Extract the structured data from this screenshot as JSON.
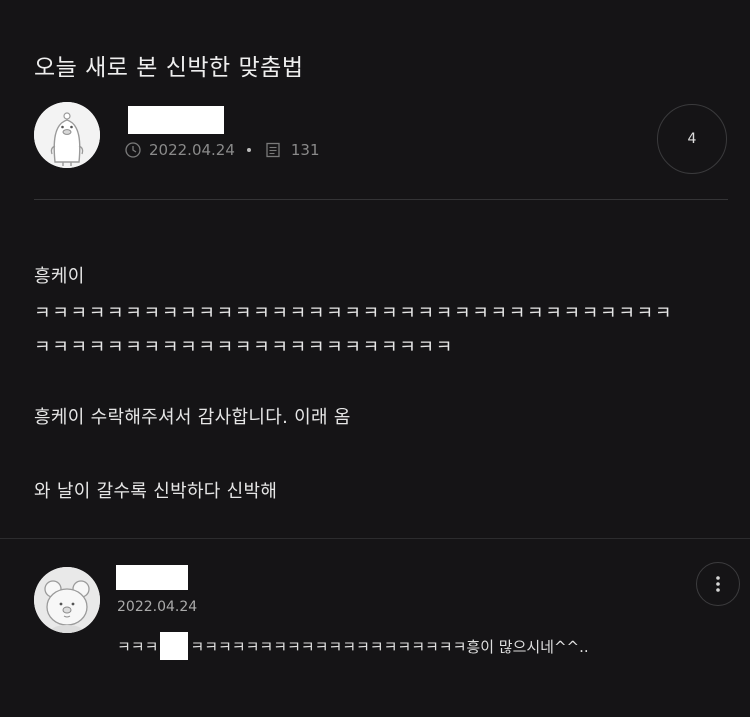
{
  "post": {
    "title": "오늘 새로 본 신박한 맞춤법",
    "date": "2022.04.24",
    "views": "131",
    "comment_count": "4",
    "body": {
      "line1": "흥케이",
      "line2": "ㅋㅋㅋㅋㅋㅋㅋㅋㅋㅋㅋㅋㅋㅋㅋㅋㅋㅋㅋㅋㅋㅋㅋㅋㅋㅋㅋㅋㅋㅋㅋㅋㅋㅋㅋ",
      "line3": "ㅋㅋㅋㅋㅋㅋㅋㅋㅋㅋㅋㅋㅋㅋㅋㅋㅋㅋㅋㅋㅋㅋㅋ",
      "line4": "흥케이 수락해주셔서 감사합니다. 이래 옴",
      "line5": "와 날이 갈수록 신박하다 신박해"
    }
  },
  "comment": {
    "date": "2022.04.24",
    "text_prefix": "ㅋㅋㅋ",
    "text_suffix": "ㅋㅋㅋㅋㅋㅋㅋㅋㅋㅋㅋㅋㅋㅋㅋㅋㅋㅋㅋㅋ흥이 많으시네^^.."
  },
  "icons": {
    "date": "clock-icon",
    "views": "document-icon",
    "more": "more-vertical-icon"
  }
}
